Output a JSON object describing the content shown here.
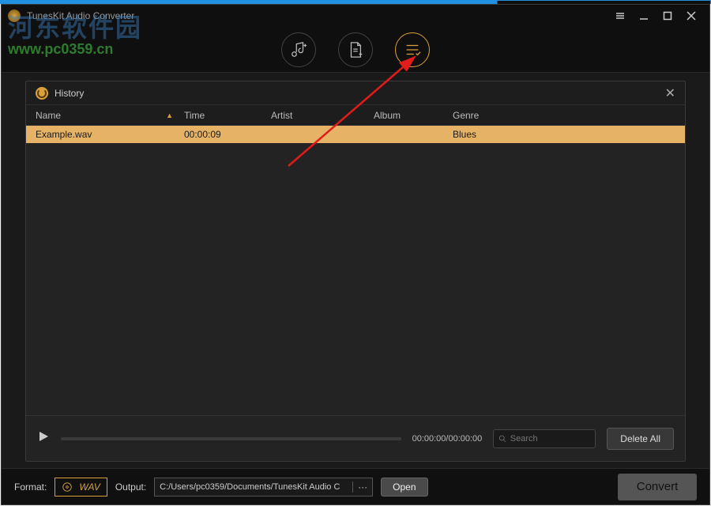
{
  "app": {
    "title": "TunesKit Audio Converter"
  },
  "watermark": {
    "cn": "河东软件园",
    "url": "www.pc0359.cn"
  },
  "history": {
    "title": "History",
    "columns": {
      "name": "Name",
      "time": "Time",
      "artist": "Artist",
      "album": "Album",
      "genre": "Genre"
    },
    "rows": [
      {
        "name": "Example.wav",
        "time": "00:00:09",
        "artist": "",
        "album": "",
        "genre": "Blues"
      }
    ]
  },
  "playback": {
    "time": "00:00:00/00:00:00"
  },
  "search": {
    "placeholder": "Search"
  },
  "buttons": {
    "delete_all": "Delete All",
    "open": "Open",
    "convert": "Convert"
  },
  "footer": {
    "format_label": "Format:",
    "format_value": "WAV",
    "output_label": "Output:",
    "output_path": "C:/Users/pc0359/Documents/TunesKit Audio C"
  }
}
